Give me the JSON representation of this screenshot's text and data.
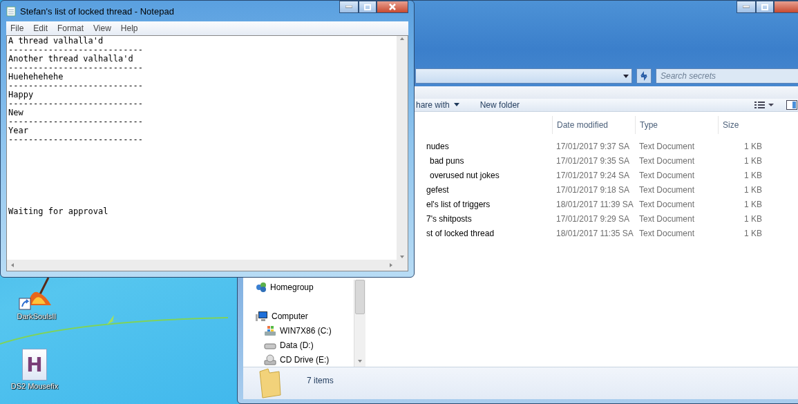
{
  "desktop_icons": [
    {
      "kind": "bonfire",
      "label": "DarkSoulsII"
    },
    {
      "kind": "letter",
      "label": "DS2 Mousefix",
      "glyph": "H"
    }
  ],
  "explorer": {
    "search": {
      "placeholder": "Search secrets"
    },
    "toolbar": [
      {
        "label": "hare with",
        "dropdown": true
      },
      {
        "label": "New folder",
        "dropdown": false
      }
    ],
    "columns": [
      "Date modified",
      "Type",
      "Size"
    ],
    "rows": [
      {
        "name": "nudes",
        "date": "17/01/2017 9:37 SA",
        "type": "Text Document",
        "size": "1 KB"
      },
      {
        "name": "bad puns",
        "date": "17/01/2017 9:35 SA",
        "type": "Text Document",
        "size": "1 KB"
      },
      {
        "name": "overused nut jokes",
        "date": "17/01/2017 9:24 SA",
        "type": "Text Document",
        "size": "1 KB"
      },
      {
        "name": "gefest",
        "date": "17/01/2017 9:18 SA",
        "type": "Text Document",
        "size": "1 KB"
      },
      {
        "name": "el's list of triggers",
        "date": "18/01/2017 11:39 SA",
        "type": "Text Document",
        "size": "1 KB"
      },
      {
        "name": "7's shitposts",
        "date": "17/01/2017 9:29 SA",
        "type": "Text Document",
        "size": "1 KB"
      },
      {
        "name": "st of locked thread",
        "date": "18/01/2017 11:35 SA",
        "type": "Text Document",
        "size": "1 KB"
      }
    ],
    "nav": [
      {
        "kind": "homegroup",
        "label": "Homegroup"
      },
      {
        "kind": "computer",
        "label": "Computer",
        "children": [
          {
            "kind": "system-drive",
            "label": "WIN7X86 (C:)"
          },
          {
            "kind": "drive",
            "label": "Data (D:)"
          },
          {
            "kind": "cd",
            "label": "CD Drive (E:)"
          }
        ]
      }
    ],
    "status": "7 items"
  },
  "notepad": {
    "title": "Stefan's list of locked thread - Notepad",
    "menu": [
      "File",
      "Edit",
      "Format",
      "View",
      "Help"
    ],
    "text": "A thread valhalla'd\n---------------------------\nAnother thread valhalla'd\n---------------------------\nHuehehehehe\n---------------------------\nHappy\n---------------------------\nNew\n---------------------------\nYear\n---------------------------\n\n\n\n\n\n\n\nWaiting for approval"
  }
}
